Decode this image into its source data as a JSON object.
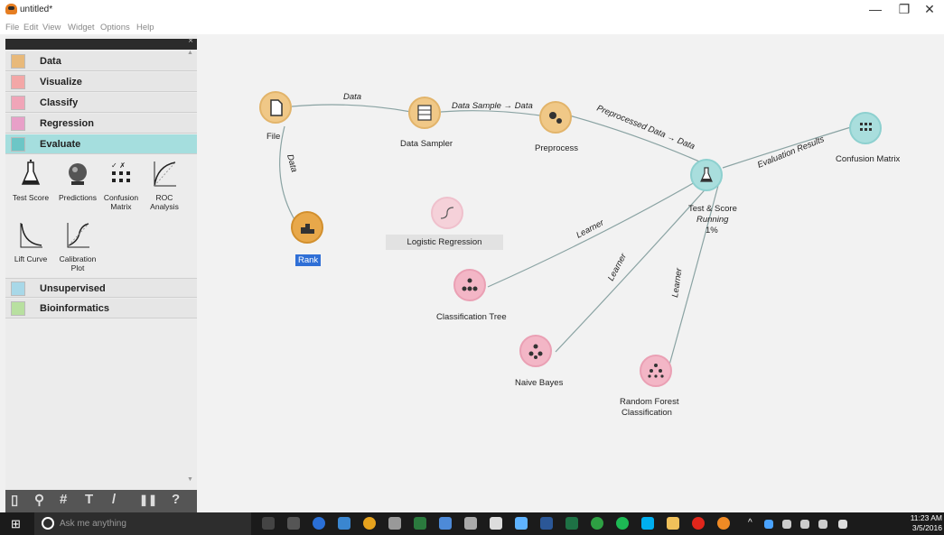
{
  "window": {
    "title": "untitled*",
    "minimize": "—",
    "maximize": "❐",
    "close": "✕"
  },
  "menu": [
    "File",
    "Edit",
    "View",
    "Widget",
    "Options",
    "Help"
  ],
  "categories": [
    {
      "label": "Data",
      "color": "#e8b97a"
    },
    {
      "label": "Visualize",
      "color": "#f3a7a7"
    },
    {
      "label": "Classify",
      "color": "#f0a5b8"
    },
    {
      "label": "Regression",
      "color": "#e8a0c8"
    },
    {
      "label": "Evaluate",
      "color": "#6cc6c6"
    },
    {
      "label": "Unsupervised",
      "color": "#a8d8e8"
    },
    {
      "label": "Bioinformatics",
      "color": "#b8e0a0"
    }
  ],
  "tools": [
    {
      "label": "Test Score"
    },
    {
      "label": "Predictions"
    },
    {
      "label": "Confusion Matrix"
    },
    {
      "label": "ROC Analysis"
    },
    {
      "label": "Lift Curve"
    },
    {
      "label": "Calibration Plot"
    }
  ],
  "bottom_tools": [
    "▯",
    "⚲",
    "#",
    "T",
    "/",
    "❚❚",
    "?"
  ],
  "nodes": {
    "file": "File",
    "data_sampler": "Data Sampler",
    "preprocess": "Preprocess",
    "rank": "Rank",
    "logistic_regression": "Logistic Regression",
    "classification_tree": "Classification Tree",
    "naive_bayes": "Naive Bayes",
    "random_forest_line1": "Random Forest",
    "random_forest_line2": "Classification",
    "test_score": "Test & Score",
    "test_score_status": "Running",
    "test_score_progress": "1%",
    "confusion_matrix": "Confusion Matrix"
  },
  "links": {
    "file_sampler": "Data",
    "file_rank": "Data",
    "sampler_preprocess": "Data Sample → Data",
    "preprocess_test": "Preprocessed Data → Data",
    "test_confusion": "Evaluation Results",
    "tree_test": "Learner",
    "bayes_test": "Learner",
    "forest_test": "Learner"
  },
  "taskbar": {
    "search_placeholder": "Ask me anything",
    "time": "11:23 AM",
    "date": "3/5/2016"
  }
}
